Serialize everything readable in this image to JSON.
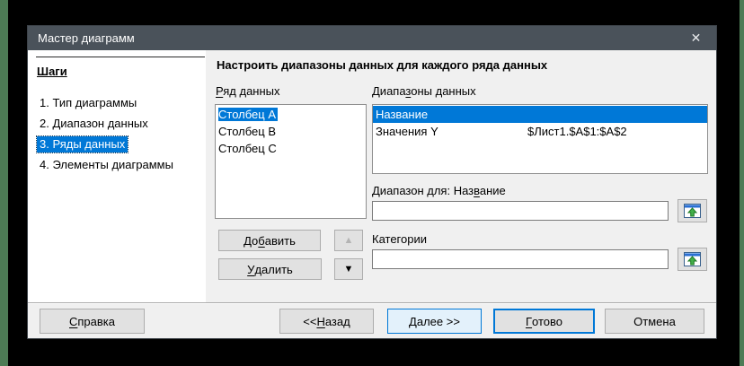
{
  "window": {
    "title": "Мастер диаграмм",
    "close_glyph": "✕"
  },
  "sidebar": {
    "heading": "Шаги",
    "steps": [
      {
        "label": "1. Тип диаграммы",
        "selected": false
      },
      {
        "label": "2. Диапазон данных",
        "selected": false
      },
      {
        "label": "3. Ряды данных",
        "selected": true
      },
      {
        "label": "4. Элементы диаграммы",
        "selected": false
      }
    ]
  },
  "main": {
    "heading": "Настроить диапазоны данных для каждого ряда данных",
    "series": {
      "label": "~Ряд данных",
      "items": [
        "Столбец A",
        "Столбец B",
        "Столбец C"
      ],
      "selected_index": 0
    },
    "ranges": {
      "label": "Диапа~зоны данных",
      "rows": [
        {
          "name": "Название",
          "range": "",
          "selected": true
        },
        {
          "name": "Значения Y",
          "range": "$Лист1.$A$1:$A$2",
          "selected": false
        }
      ]
    },
    "range_for": {
      "label": "Диапазон для: Наз~вание",
      "value": ""
    },
    "categories": {
      "label": "Категории",
      "value": ""
    },
    "actions": {
      "add": "До~бавить",
      "remove": "~Удалить",
      "up_glyph": "▲",
      "down_glyph": "▼"
    }
  },
  "footer": {
    "help": "~Справка",
    "back": "<< ~Назад",
    "next": "~Далее >>",
    "finish": "~Готово",
    "cancel": "Отмена"
  },
  "icons": {
    "range_pick": "select-data-range",
    "up": "move-up-arrow",
    "down": "move-down-arrow",
    "close": "window-close"
  },
  "colors": {
    "selection_blue": "#0078d7",
    "titlebar": "#4a525a",
    "dialog_bg": "#f0f0f0",
    "edge_green": "#4d7b55",
    "next_button_bg": "#e3f1fb"
  }
}
